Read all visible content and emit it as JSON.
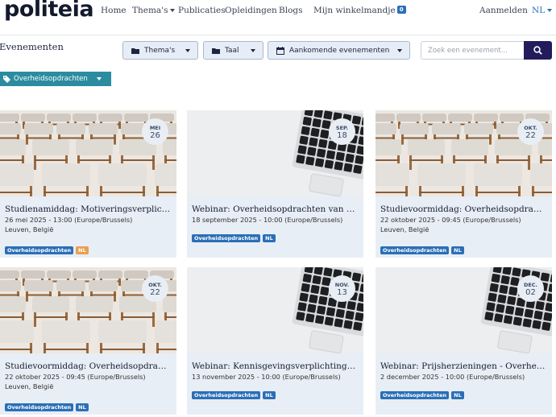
{
  "brand": {
    "logo_text": "politeia"
  },
  "nav": {
    "home": "Home",
    "themes": "Thema's",
    "publications": "Publicaties",
    "courses": "Opleidingen",
    "blogs": "Blogs",
    "cart": "Mijn winkelmandje",
    "cart_count": "0",
    "login": "Aanmelden",
    "language": "NL"
  },
  "filters": {
    "heading": "Evenementen",
    "themes_label": "Thema's",
    "language_label": "Taal",
    "date_label": "Aankomende evenementen",
    "search_placeholder": "Zoek een evenement...",
    "active_tag": "Overheidsopdrachten"
  },
  "events": [
    {
      "title": "Studienamiddag: Motiveringsverplichting en ...",
      "date": "26 mei 2025 - 13:00 (Europe/Brussels)",
      "location": "Leuven, België",
      "badge_month": "MEI",
      "badge_day": "26",
      "image": "chairs",
      "tags": [
        "Overheidsopdrachten",
        "NL"
      ],
      "lang_color": "#e9a04f"
    },
    {
      "title": "Webinar: Overheidsopdrachten van bepaalde ...",
      "date": "18 september 2025 - 10:00 (Europe/Brussels)",
      "location": "",
      "badge_month": "SEP.",
      "badge_day": "18",
      "image": "laptop",
      "tags": [
        "Overheidsopdrachten",
        "NL"
      ],
      "lang_color": "#2a6fb6"
    },
    {
      "title": "Studievoormiddag: Overheidsopdrachten ...",
      "date": "22 oktober 2025 - 09:45 (Europe/Brussels)",
      "location": "Leuven, België",
      "badge_month": "OKT.",
      "badge_day": "22",
      "image": "chairs",
      "tags": [
        "Overheidsopdrachten",
        "NL"
      ],
      "lang_color": "#2a6fb6"
    },
    {
      "title": "Studievoormiddag: Overheidsopdrachten ...",
      "date": "22 oktober 2025 - 09:45 (Europe/Brussels)",
      "location": "Leuven, België",
      "badge_month": "OKT.",
      "badge_day": "22",
      "image": "chairs",
      "tags": [
        "Overheidsopdrachten",
        "NL"
      ],
      "lang_color": "#2a6fb6"
    },
    {
      "title": "Webinar: Kennisgevingsverplichtingen ...",
      "date": "13 november 2025 - 10:00 (Europe/Brussels)",
      "location": "",
      "badge_month": "NOV.",
      "badge_day": "13",
      "image": "laptop",
      "tags": [
        "Overheidsopdrachten",
        "NL"
      ],
      "lang_color": "#2a6fb6"
    },
    {
      "title": "Webinar: Prijsherzieningen - Overheidsopdrachten",
      "date": "2 december 2025 - 10:00 (Europe/Brussels)",
      "location": "",
      "badge_month": "DEC.",
      "badge_day": "02",
      "image": "laptop",
      "tags": [
        "Overheidsopdrachten",
        "NL"
      ],
      "lang_color": "#2a6fb6"
    }
  ]
}
